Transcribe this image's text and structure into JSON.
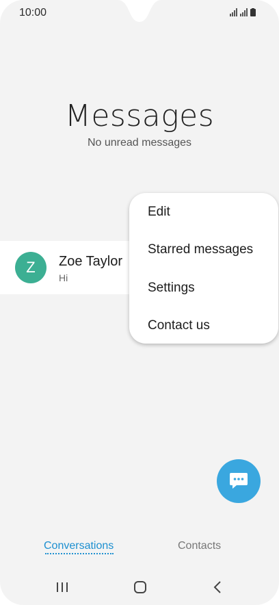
{
  "status_bar": {
    "time": "10:00"
  },
  "header": {
    "title": "Messages",
    "subtitle": "No unread messages"
  },
  "conversation": {
    "avatar_letter": "Z",
    "name": "Zoe Taylor",
    "snippet": "Hi",
    "avatar_color": "#3caf93"
  },
  "menu": {
    "items": [
      "Edit",
      "Starred messages",
      "Settings",
      "Contact us"
    ]
  },
  "fab": {
    "icon": "compose-message-icon",
    "color": "#3aa7df"
  },
  "tabs": {
    "conversations": "Conversations",
    "contacts": "Contacts",
    "active_color": "#1c8fd0"
  },
  "nav_bar": {
    "icons": [
      "recents-icon",
      "home-icon",
      "back-icon"
    ]
  }
}
